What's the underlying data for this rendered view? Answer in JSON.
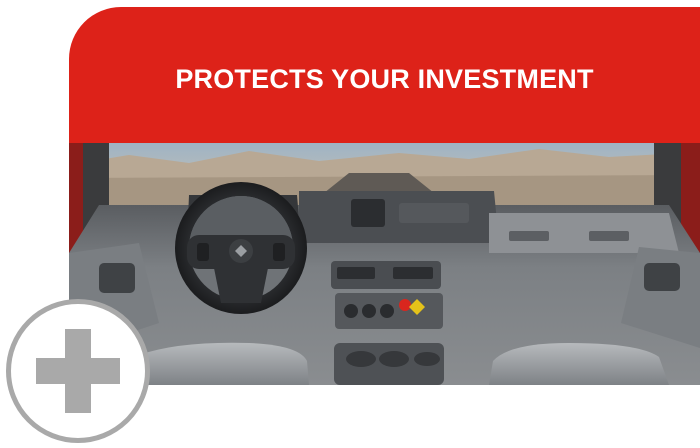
{
  "banner": {
    "title": "PROTECTS YOUR INVESTMENT"
  },
  "photo": {
    "subject": "truck-cab-interior"
  },
  "badge": {
    "icon": "plus-icon"
  },
  "colors": {
    "banner_red": "#dd2219",
    "badge_gray": "#a9a9a9",
    "text_white": "#ffffff"
  }
}
